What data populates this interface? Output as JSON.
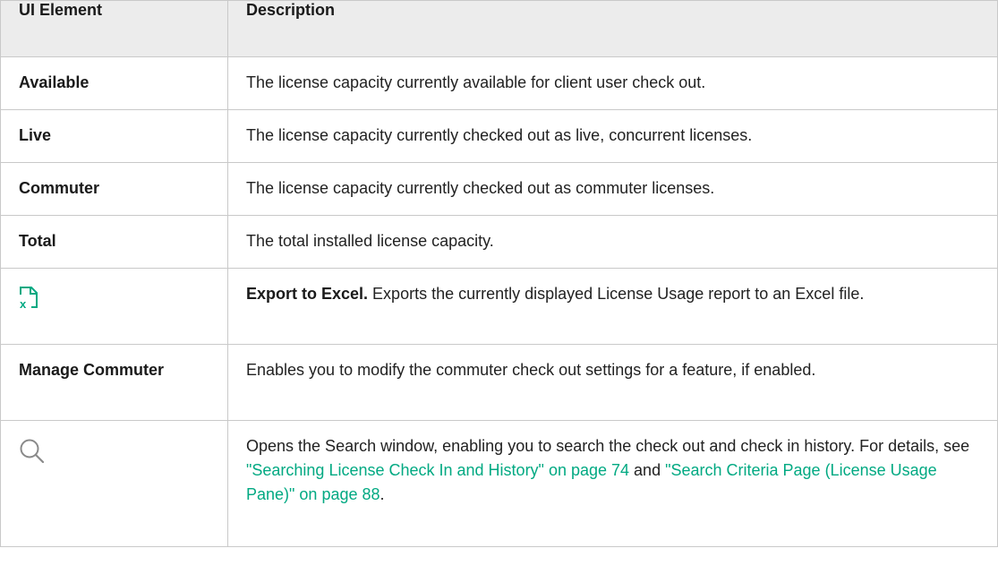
{
  "header": {
    "col_element": "UI Element",
    "col_description": "Description"
  },
  "rows": [
    {
      "element": "Available",
      "description": "The license capacity currently available for client user check out."
    },
    {
      "element": "Live",
      "description": "The license capacity currently checked out as live, concurrent licenses."
    },
    {
      "element": "Commuter",
      "description": "The license capacity currently checked out as commuter licenses."
    },
    {
      "element": "Total",
      "description": "The total installed license capacity."
    },
    {
      "icon": "export-to-excel-icon",
      "description_bold": "Export to Excel.",
      "description": " Exports the currently displayed License Usage report to an Excel file."
    },
    {
      "element": "Manage Commuter",
      "description": "Enables you to modify the commuter check out settings for a feature, if enabled."
    },
    {
      "icon": "search-icon",
      "description_start": "Opens the Search window, enabling you to search the check out and check in history. For details, see ",
      "link1": "\"Searching License Check In and History\" on page 74",
      "description_mid": " and ",
      "link2": "\"Search Criteria Page (License Usage Pane)\" on page 88",
      "description_end": "."
    }
  ],
  "colors": {
    "link": "#01a982",
    "excel_icon": "#01a982",
    "header_bg": "#ececec",
    "border": "#c9c9c9"
  }
}
